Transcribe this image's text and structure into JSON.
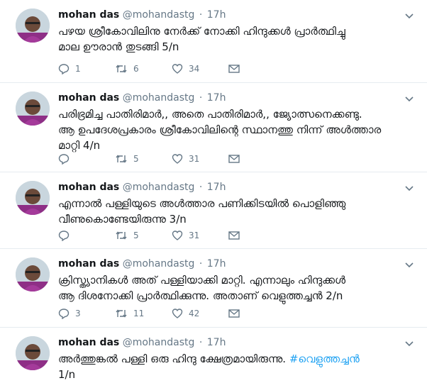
{
  "tweets": [
    {
      "author_name": "mohan das",
      "handle": "@mohandastg",
      "separator": "·",
      "time": "17h",
      "text": "പഴയ ശ്രീകോവിലിനു നേർക്ക് നോക്കി ഹിന്ദുക്കൾ പ്രാർത്ഥിച്ചു\nമാല ഊരാൻ തുടങ്ങി 5/n",
      "hashtag": "",
      "text_tail": "",
      "replies": "1",
      "retweets": "6",
      "likes": "34"
    },
    {
      "author_name": "mohan das",
      "handle": "@mohandastg",
      "separator": "·",
      "time": "17h",
      "text": "പരിഭ്രമിച്ച പാതിരിമാർ,, അതെ പാതിരിമാർ,, ജ്യോത്സനെക്കണ്ടു.\nആ ഉപദേശപ്രകാരം ശ്രീകോവിലിന്റെ സ്ഥാനത്തു നിന്ന് അൾത്താര\nമാറ്റി  4/n",
      "hashtag": "",
      "text_tail": "",
      "replies": "",
      "retweets": "5",
      "likes": "31"
    },
    {
      "author_name": "mohan das",
      "handle": "@mohandastg",
      "separator": "·",
      "time": "17h",
      "text": "എന്നാൽ പള്ളിയുടെ അൾത്താര പണിക്കിടയിൽ പൊളിഞ്ഞു\nവീണുകൊണ്ടേയിരുന്നു 3/n",
      "hashtag": "",
      "text_tail": "",
      "replies": "",
      "retweets": "5",
      "likes": "31"
    },
    {
      "author_name": "mohan das",
      "handle": "@mohandastg",
      "separator": "·",
      "time": "17h",
      "text": "ക്രിസ്ത്യാനികൾ അത് പള്ളിയാക്കി മാറ്റി. എന്നാലും ഹിന്ദുക്കൾ\nആ ദിശനോക്കി പ്രാർത്ഥിക്കുന്നു. അതാണ് വെളുത്തച്ചൻ 2/n",
      "hashtag": "",
      "text_tail": "",
      "replies": "3",
      "retweets": "11",
      "likes": "42"
    },
    {
      "author_name": "mohan das",
      "handle": "@mohandastg",
      "separator": "·",
      "time": "17h",
      "text": "അർത്തുങ്കൽ പള്ളി ഒരു ഹിന്ദു ക്ഷേത്രമായിരുന്നു. ",
      "hashtag": "#വെളുത്തച്ചൻ",
      "text_tail": "\n1/n",
      "replies": "",
      "retweets": "",
      "likes": ""
    }
  ],
  "icons": {
    "reply": "reply-icon",
    "retweet": "retweet-icon",
    "like": "heart-icon",
    "message": "envelope-icon",
    "caret": "chevron-down-icon"
  },
  "colors": {
    "text": "#14171a",
    "muted": "#657786",
    "link": "#1da1f2",
    "divider": "#e6ecf0"
  }
}
